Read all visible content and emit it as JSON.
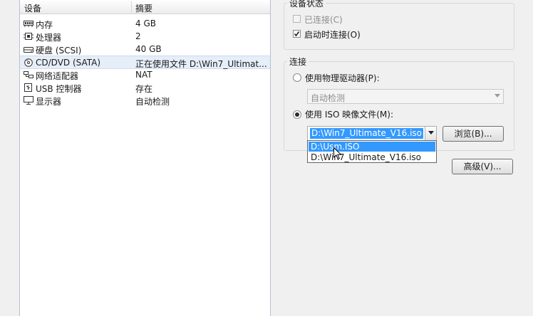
{
  "device_list": {
    "headers": {
      "device": "设备",
      "summary": "摘要"
    },
    "rows": [
      {
        "name": "内存",
        "summary": "4 GB",
        "icon": "memory-icon"
      },
      {
        "name": "处理器",
        "summary": "2",
        "icon": "cpu-icon"
      },
      {
        "name": "硬盘 (SCSI)",
        "summary": "40 GB",
        "icon": "hard-disk-icon"
      },
      {
        "name": "CD/DVD (SATA)",
        "summary": "正在使用文件 D:\\Win7_Ultimat...",
        "icon": "cd-dvd-icon",
        "selected": true
      },
      {
        "name": "网络适配器",
        "summary": "NAT",
        "icon": "network-adapter-icon"
      },
      {
        "name": "USB 控制器",
        "summary": "存在",
        "icon": "usb-icon"
      },
      {
        "name": "显示器",
        "summary": "自动检测",
        "icon": "display-icon"
      }
    ]
  },
  "device_status": {
    "legend": "设备状态",
    "connected_label": "已连接(C)",
    "connected_checked": false,
    "connect_at_power_on_label": "启动时连接(O)",
    "connect_at_power_on_checked": true
  },
  "connection": {
    "legend": "连接",
    "physical_drive_label": "使用物理驱动器(P):",
    "physical_drive_value": "自动检测",
    "iso_label": "使用 ISO 映像文件(M):",
    "iso_value": "D:\\Win7_Ultimate_V16.iso",
    "dropdown_options": [
      "D:\\Usm.ISO",
      "D:\\Win7_Ultimate_V16.iso"
    ],
    "browse_label": "浏览(B)...",
    "selected_mode": "iso"
  },
  "advanced_label": "高级(V)...",
  "colors": {
    "selection_blue": "#3399ff",
    "row_highlight": "#e5eef9"
  }
}
